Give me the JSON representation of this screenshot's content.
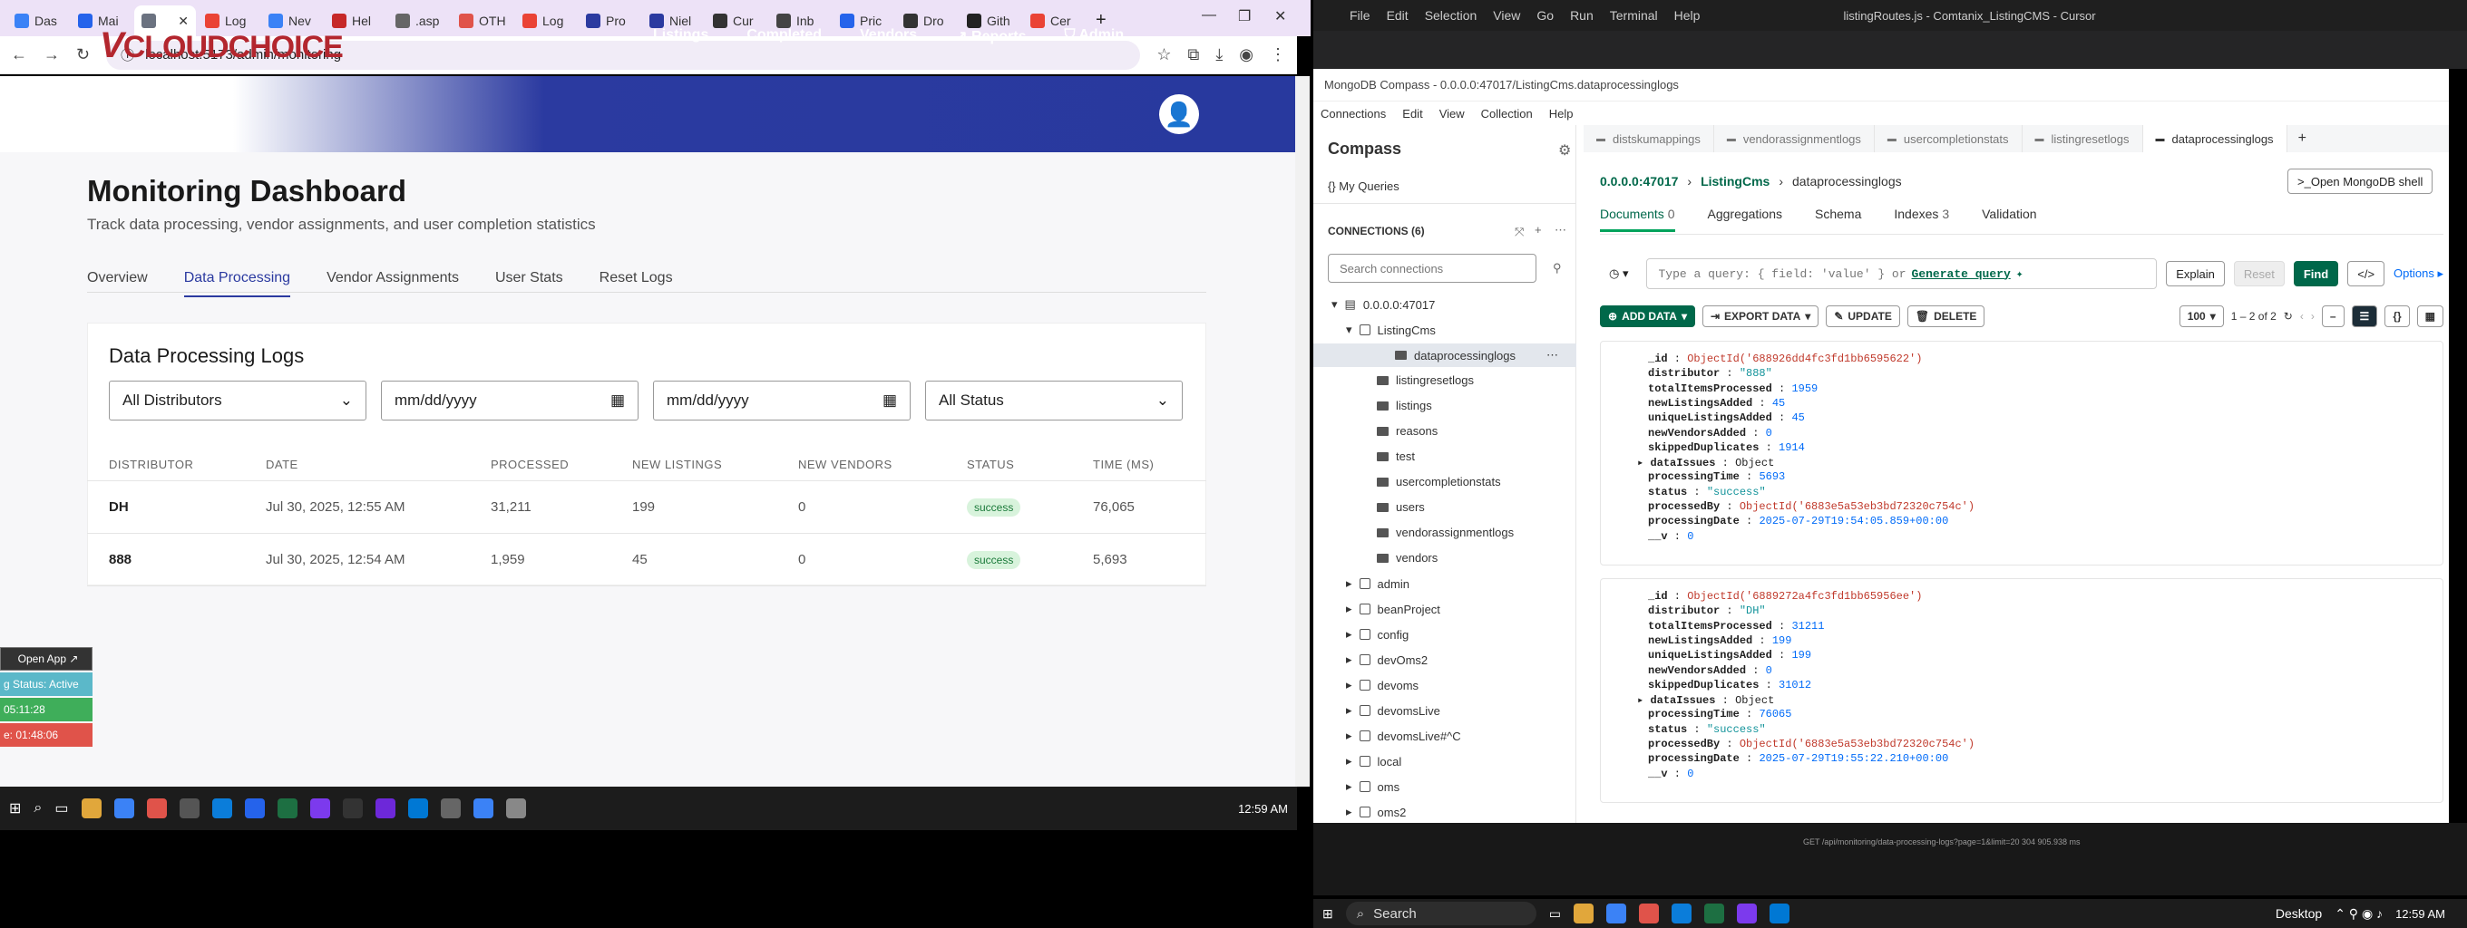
{
  "browser": {
    "tabs": [
      "Das",
      "Mai",
      "",
      "Log",
      "Nev",
      "Hel",
      ".asp",
      "OTH",
      "Log",
      "Pro",
      "Niel",
      "Cur",
      "Inb",
      "Pric",
      "Dro",
      "Gith",
      "Cer"
    ],
    "url": "localhost:5173/admin/monitoring"
  },
  "app": {
    "logo_v": "V",
    "logo_cloud": "CLOUD",
    "logo_choice": "CHOICE",
    "nav": [
      "Listings",
      "Completed",
      "Vendors",
      "Reports",
      "Admin"
    ],
    "title": "Monitoring Dashboard",
    "subtitle": "Track data processing, vendor assignments, and user completion statistics",
    "subtabs": [
      "Overview",
      "Data Processing",
      "Vendor Assignments",
      "User Stats",
      "Reset Logs"
    ],
    "card_title": "Data Processing Logs",
    "filters": {
      "distributor": "All Distributors",
      "date1": "mm/dd/yyyy",
      "date2": "mm/dd/yyyy",
      "status": "All Status"
    },
    "columns": [
      "DISTRIBUTOR",
      "DATE",
      "PROCESSED",
      "NEW LISTINGS",
      "NEW VENDORS",
      "STATUS",
      "TIME (MS)"
    ],
    "rows": [
      {
        "distributor": "DH",
        "date": "Jul 30, 2025, 12:55 AM",
        "processed": "31,211",
        "new_listings": "199",
        "new_vendors": "0",
        "status": "success",
        "time": "76,065"
      },
      {
        "distributor": "888",
        "date": "Jul 30, 2025, 12:54 AM",
        "processed": "1,959",
        "new_listings": "45",
        "new_vendors": "0",
        "status": "success",
        "time": "5,693"
      }
    ]
  },
  "widget": {
    "open_app": "Open App ↗",
    "status": "g Status: Active",
    "time1": "05:11:28",
    "time2": "e: 01:48:06"
  },
  "left_clock": "12:59 AM",
  "cursor": {
    "menu": [
      "File",
      "Edit",
      "Selection",
      "View",
      "Go",
      "Run",
      "Terminal",
      "Help"
    ],
    "title": "listingRoutes.js - Comtanix_ListingCMS - Cursor"
  },
  "compass": {
    "window_title": "MongoDB Compass - 0.0.0.0:47017/ListingCms.dataprocessinglogs",
    "menu": [
      "Connections",
      "Edit",
      "View",
      "Collection",
      "Help"
    ],
    "app_name": "Compass",
    "my_queries": "My Queries",
    "connections_label": "CONNECTIONS (6)",
    "search_placeholder": "Search connections",
    "host": "0.0.0.0:47017",
    "db": "ListingCms",
    "collections": [
      "dataprocessinglogs",
      "listingresetlogs",
      "listings",
      "reasons",
      "test",
      "usercompletionstats",
      "users",
      "vendorassignmentlogs",
      "vendors"
    ],
    "other_dbs": [
      "admin",
      "beanProject",
      "config",
      "devOms2",
      "devoms",
      "devomsLive",
      "devomsLive#^C",
      "local",
      "oms",
      "oms2"
    ],
    "tabs": [
      "distskumappings",
      "vendorassignmentlogs",
      "usercompletionstats",
      "listingresetlogs",
      "dataprocessinglogs"
    ],
    "breadcrumb": [
      "0.0.0.0:47017",
      "ListingCms",
      "dataprocessinglogs"
    ],
    "shell_btn": "Open MongoDB shell",
    "subtabs": [
      "Documents",
      "Aggregations",
      "Schema",
      "Indexes",
      "Validation"
    ],
    "docs_count": "0",
    "indexes_count": "3",
    "query_placeholder": "Type a query: { field: 'value' } or",
    "generate_query": "Generate query",
    "explain": "Explain",
    "reset": "Reset",
    "find": "Find",
    "options": "Options",
    "add_data": "ADD DATA",
    "export_data": "EXPORT DATA",
    "update": "UPDATE",
    "delete": "DELETE",
    "page_size": "100",
    "range": "1 – 2 of 2",
    "docs": [
      [
        [
          "_id",
          "ObjectId('688926dd4fc3fd1bb6595622')",
          "o"
        ],
        [
          "distributor",
          "\"888\"",
          "s"
        ],
        [
          "totalItemsProcessed",
          "1959",
          "n"
        ],
        [
          "newListingsAdded",
          "45",
          "n"
        ],
        [
          "uniqueListingsAdded",
          "45",
          "n"
        ],
        [
          "newVendorsAdded",
          "0",
          "n"
        ],
        [
          "skippedDuplicates",
          "1914",
          "n"
        ],
        [
          "dataIssues",
          "Object",
          ""
        ],
        [
          "processingTime",
          "5693",
          "n"
        ],
        [
          "status",
          "\"success\"",
          "s"
        ],
        [
          "processedBy",
          "ObjectId('6883e5a53eb3bd72320c754c')",
          "o"
        ],
        [
          "processingDate",
          "2025-07-29T19:54:05.859+00:00",
          "n"
        ],
        [
          "__v",
          "0",
          "n"
        ]
      ],
      [
        [
          "_id",
          "ObjectId('6889272a4fc3fd1bb65956ee')",
          "o"
        ],
        [
          "distributor",
          "\"DH\"",
          "s"
        ],
        [
          "totalItemsProcessed",
          "31211",
          "n"
        ],
        [
          "newListingsAdded",
          "199",
          "n"
        ],
        [
          "uniqueListingsAdded",
          "199",
          "n"
        ],
        [
          "newVendorsAdded",
          "0",
          "n"
        ],
        [
          "skippedDuplicates",
          "31012",
          "n"
        ],
        [
          "dataIssues",
          "Object",
          ""
        ],
        [
          "processingTime",
          "76065",
          "n"
        ],
        [
          "status",
          "\"success\"",
          "s"
        ],
        [
          "processedBy",
          "ObjectId('6883e5a53eb3bd72320c754c')",
          "o"
        ],
        [
          "processingDate",
          "2025-07-29T19:55:22.210+00:00",
          "n"
        ],
        [
          "__v",
          "0",
          "n"
        ]
      ]
    ]
  },
  "terminal": {
    "line": "GET /api/monitoring/data-processing-logs?page=1&limit=20 304 905.938 ms"
  },
  "right_taskbar": {
    "search": "Search",
    "desktop": "Desktop",
    "clock": "12:59 AM"
  },
  "colors": {
    "nav": "#28399e",
    "brand_red": "#b3262e",
    "compass_green": "#00684a"
  }
}
